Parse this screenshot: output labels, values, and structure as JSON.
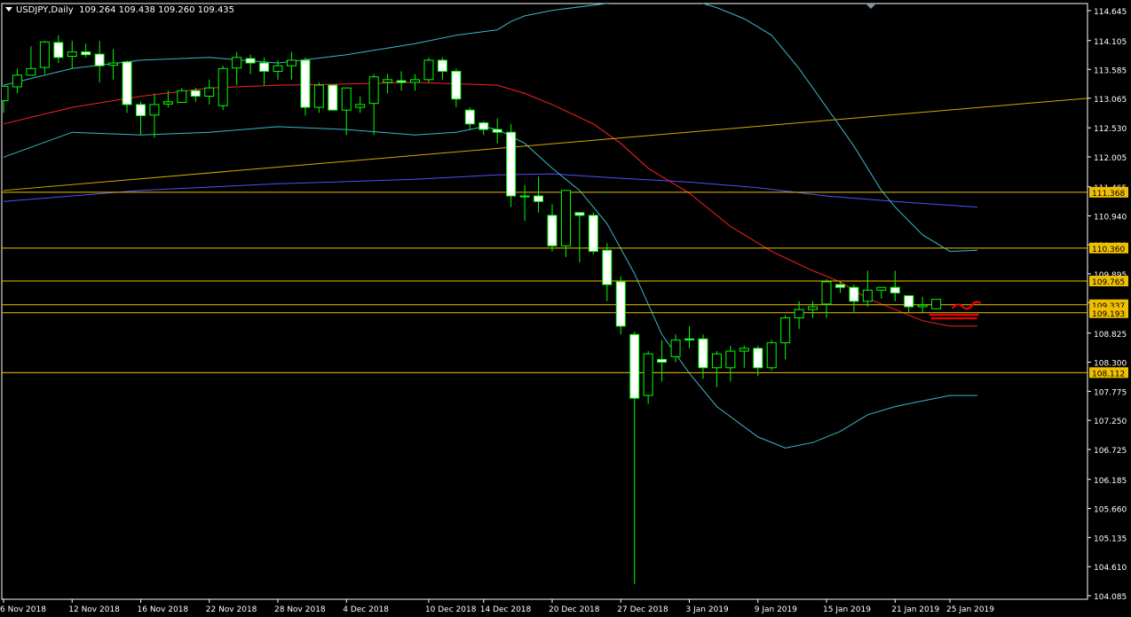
{
  "header": {
    "symbol": "USDJPY,Daily",
    "ohlc": "109.264 109.438 109.260 109.435"
  },
  "colors": {
    "background": "#000000",
    "axis": "#ffffff",
    "grid_text": "#ffffff",
    "bull_candle": "#000000",
    "bear_candle": "#ffffff",
    "wick": "#00ff00",
    "bollinger": "#3cb8c8",
    "ma_red": "#ff2020",
    "ma_blue": "#5050ff",
    "level_line": "#f0c000",
    "level_label_bg": "#f0c000",
    "trendline": "#d6a800",
    "annotation": "#ff0000"
  },
  "chart_data": {
    "type": "candlestick",
    "symbol": "USDJPY",
    "timeframe": "Daily",
    "y_ticks": [
      "114.645",
      "114.105",
      "113.585",
      "113.065",
      "112.530",
      "112.005",
      "111.465",
      "110.940",
      "110.420",
      "109.895",
      "109.375",
      "108.825",
      "108.300",
      "107.775",
      "107.250",
      "106.725",
      "106.185",
      "105.660",
      "105.135",
      "104.610",
      "104.085"
    ],
    "ylim": [
      104.085,
      114.645
    ],
    "x_ticks": [
      "6 Nov 2018",
      "12 Nov 2018",
      "16 Nov 2018",
      "22 Nov 2018",
      "28 Nov 2018",
      "4 Dec 2018",
      "10 Dec 2018",
      "14 Dec 2018",
      "20 Dec 2018",
      "27 Dec 2018",
      "3 Jan 2019",
      "9 Jan 2019",
      "15 Jan 2019",
      "21 Jan 2019",
      "25 Jan 2019"
    ],
    "x_tick_index": [
      0,
      5,
      10,
      15,
      20,
      25,
      31,
      35,
      40,
      45,
      50,
      55,
      60,
      65,
      69
    ],
    "levels": [
      {
        "price": 111.368,
        "label": "111.368"
      },
      {
        "price": 110.36,
        "label": "110.360"
      },
      {
        "price": 109.765,
        "label": "109.765"
      },
      {
        "price": 109.337,
        "label": "109.337"
      },
      {
        "price": 109.193,
        "label": "109.193"
      },
      {
        "price": 108.112,
        "label": "108.112"
      }
    ],
    "trendline": {
      "start": [
        0,
        111.4
      ],
      "end": [
        95,
        113.4
      ]
    },
    "candles": [
      [
        113.02,
        113.25,
        112.8,
        113.28
      ],
      [
        113.27,
        113.6,
        113.15,
        113.48
      ],
      [
        113.48,
        114.0,
        113.5,
        113.6
      ],
      [
        113.62,
        114.1,
        113.5,
        114.08
      ],
      [
        114.07,
        114.2,
        113.7,
        113.8
      ],
      [
        113.82,
        114.1,
        113.6,
        113.9
      ],
      [
        113.9,
        114.05,
        113.8,
        113.85
      ],
      [
        113.86,
        114.1,
        113.35,
        113.65
      ],
      [
        113.66,
        113.95,
        113.4,
        113.7
      ],
      [
        113.72,
        113.75,
        112.8,
        112.95
      ],
      [
        112.95,
        113.0,
        112.4,
        112.75
      ],
      [
        112.76,
        113.15,
        112.35,
        112.95
      ],
      [
        112.96,
        113.2,
        112.9,
        113.0
      ],
      [
        112.99,
        113.25,
        113.05,
        113.2
      ],
      [
        113.2,
        113.25,
        113.0,
        113.1
      ],
      [
        113.1,
        113.4,
        112.95,
        113.25
      ],
      [
        112.93,
        113.65,
        112.85,
        113.6
      ],
      [
        113.61,
        113.9,
        113.3,
        113.8
      ],
      [
        113.78,
        113.85,
        113.5,
        113.7
      ],
      [
        113.7,
        113.8,
        113.3,
        113.55
      ],
      [
        113.55,
        113.75,
        113.4,
        113.65
      ],
      [
        113.65,
        113.9,
        113.4,
        113.75
      ],
      [
        113.75,
        113.8,
        112.75,
        112.9
      ],
      [
        112.9,
        113.35,
        112.8,
        113.3
      ],
      [
        113.3,
        113.25,
        112.9,
        112.85
      ],
      [
        112.85,
        113.25,
        112.4,
        113.25
      ],
      [
        112.9,
        113.1,
        112.8,
        112.95
      ],
      [
        112.97,
        113.5,
        112.4,
        113.45
      ],
      [
        113.35,
        113.5,
        113.15,
        113.4
      ],
      [
        113.38,
        113.55,
        113.2,
        113.35
      ],
      [
        113.35,
        113.5,
        113.2,
        113.4
      ],
      [
        113.4,
        113.8,
        113.35,
        113.75
      ],
      [
        113.75,
        113.8,
        113.4,
        113.55
      ],
      [
        113.55,
        113.6,
        112.9,
        113.05
      ],
      [
        112.85,
        112.9,
        112.5,
        112.6
      ],
      [
        112.62,
        112.65,
        112.4,
        112.5
      ],
      [
        112.5,
        112.7,
        112.25,
        112.45
      ],
      [
        112.45,
        112.6,
        111.1,
        111.3
      ],
      [
        111.3,
        111.5,
        110.85,
        111.3
      ],
      [
        111.3,
        111.65,
        111.0,
        111.2
      ],
      [
        110.95,
        111.15,
        110.3,
        110.4
      ],
      [
        110.4,
        111.1,
        110.2,
        111.4
      ],
      [
        111.0,
        110.95,
        110.1,
        110.95
      ],
      [
        110.95,
        111.0,
        110.25,
        110.3
      ],
      [
        110.32,
        110.45,
        109.4,
        109.7
      ],
      [
        109.75,
        109.85,
        108.8,
        108.95
      ],
      [
        108.8,
        108.85,
        104.3,
        107.65
      ],
      [
        107.7,
        108.5,
        107.55,
        108.45
      ],
      [
        108.35,
        108.7,
        107.95,
        108.3
      ],
      [
        108.4,
        108.8,
        108.3,
        108.7
      ],
      [
        108.72,
        108.95,
        108.55,
        108.7
      ],
      [
        108.72,
        108.8,
        108.0,
        108.2
      ],
      [
        108.2,
        108.5,
        107.85,
        108.45
      ],
      [
        108.2,
        108.6,
        107.95,
        108.5
      ],
      [
        108.5,
        108.6,
        108.2,
        108.55
      ],
      [
        108.55,
        108.6,
        108.05,
        108.2
      ],
      [
        108.2,
        108.7,
        108.15,
        108.65
      ],
      [
        108.65,
        109.15,
        108.35,
        109.1
      ],
      [
        109.1,
        109.4,
        108.9,
        109.25
      ],
      [
        109.25,
        109.4,
        109.1,
        109.3
      ],
      [
        109.35,
        109.8,
        109.1,
        109.75
      ],
      [
        109.7,
        109.75,
        109.55,
        109.65
      ],
      [
        109.65,
        109.7,
        109.2,
        109.4
      ],
      [
        109.4,
        109.95,
        109.3,
        109.6
      ],
      [
        109.6,
        109.65,
        109.45,
        109.65
      ],
      [
        109.65,
        109.95,
        109.4,
        109.55
      ],
      [
        109.5,
        109.5,
        109.2,
        109.3
      ],
      [
        109.3,
        109.48,
        109.2,
        109.33
      ],
      [
        109.264,
        109.438,
        109.26,
        109.435
      ]
    ],
    "bollinger_upper_path": [
      [
        0,
        113.3
      ],
      [
        5,
        113.6
      ],
      [
        10,
        113.75
      ],
      [
        15,
        113.8
      ],
      [
        20,
        113.7
      ],
      [
        25,
        113.85
      ],
      [
        30,
        114.05
      ],
      [
        33,
        114.2
      ],
      [
        36,
        114.3
      ],
      [
        37,
        114.45
      ],
      [
        38,
        114.55
      ],
      [
        40,
        114.65
      ],
      [
        48,
        114.9
      ],
      [
        50,
        114.85
      ],
      [
        52,
        114.7
      ],
      [
        54,
        114.5
      ],
      [
        56,
        114.2
      ],
      [
        58,
        113.6
      ],
      [
        60,
        112.9
      ],
      [
        62,
        112.2
      ],
      [
        64,
        111.4
      ],
      [
        65,
        111.1
      ],
      [
        67,
        110.6
      ],
      [
        69,
        110.3
      ],
      [
        71,
        110.32
      ]
    ],
    "bollinger_lower_path": [
      [
        0,
        112.0
      ],
      [
        5,
        112.45
      ],
      [
        10,
        112.4
      ],
      [
        15,
        112.45
      ],
      [
        20,
        112.55
      ],
      [
        25,
        112.5
      ],
      [
        30,
        112.4
      ],
      [
        33,
        112.45
      ],
      [
        35,
        112.55
      ],
      [
        36,
        112.5
      ],
      [
        38,
        112.25
      ],
      [
        40,
        111.8
      ],
      [
        42,
        111.4
      ],
      [
        44,
        110.8
      ],
      [
        46,
        109.9
      ],
      [
        48,
        108.8
      ],
      [
        50,
        108.1
      ],
      [
        52,
        107.5
      ],
      [
        55,
        106.95
      ],
      [
        57,
        106.75
      ],
      [
        59,
        106.85
      ],
      [
        61,
        107.05
      ],
      [
        63,
        107.35
      ],
      [
        65,
        107.5
      ],
      [
        67,
        107.6
      ],
      [
        69,
        107.7
      ],
      [
        71,
        107.7
      ]
    ],
    "ma_red_path": [
      [
        0,
        112.6
      ],
      [
        5,
        112.9
      ],
      [
        10,
        113.1
      ],
      [
        15,
        113.25
      ],
      [
        20,
        113.3
      ],
      [
        25,
        113.32
      ],
      [
        30,
        113.35
      ],
      [
        36,
        113.3
      ],
      [
        38,
        113.15
      ],
      [
        40,
        112.95
      ],
      [
        43,
        112.6
      ],
      [
        45,
        112.25
      ],
      [
        47,
        111.8
      ],
      [
        50,
        111.35
      ],
      [
        53,
        110.75
      ],
      [
        56,
        110.3
      ],
      [
        59,
        109.95
      ],
      [
        61,
        109.75
      ],
      [
        63,
        109.45
      ],
      [
        65,
        109.25
      ],
      [
        67,
        109.05
      ],
      [
        69,
        108.95
      ],
      [
        71,
        108.95
      ]
    ],
    "ma_blue_path": [
      [
        0,
        111.2
      ],
      [
        10,
        111.4
      ],
      [
        20,
        111.52
      ],
      [
        30,
        111.6
      ],
      [
        36,
        111.68
      ],
      [
        40,
        111.7
      ],
      [
        45,
        111.62
      ],
      [
        50,
        111.55
      ],
      [
        55,
        111.45
      ],
      [
        60,
        111.3
      ],
      [
        65,
        111.2
      ],
      [
        71,
        111.1
      ]
    ],
    "annotation_marks": "red scribble near latest candle"
  }
}
